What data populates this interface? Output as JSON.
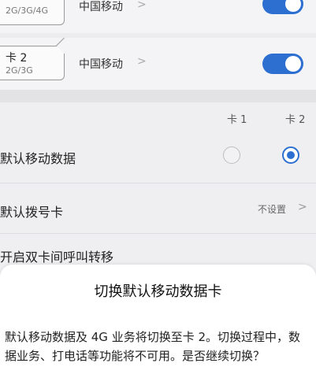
{
  "sim_rows": [
    {
      "card_label": "",
      "network_types": "2G/3G/4G",
      "carrier": "中国移动",
      "enabled": true
    },
    {
      "card_label": "卡 2",
      "network_types": "2G/3G",
      "carrier": "中国移动",
      "enabled": true
    }
  ],
  "columns": {
    "card1": "卡 1",
    "card2": "卡 2"
  },
  "default_data": {
    "label": "默认移动数据",
    "selected": "card2"
  },
  "default_dial": {
    "label": "默认拨号卡",
    "value": "不设置"
  },
  "call_forward": {
    "label": "开启双卡间呼叫转移"
  },
  "dialog": {
    "title": "切换默认移动数据卡",
    "message": "默认移动数据及 4G 业务将切换至卡 2。切换过程中，数据业务、打电话等功能将不可用。是否继续切换？"
  },
  "colors": {
    "accent": "#2d6fd1"
  }
}
